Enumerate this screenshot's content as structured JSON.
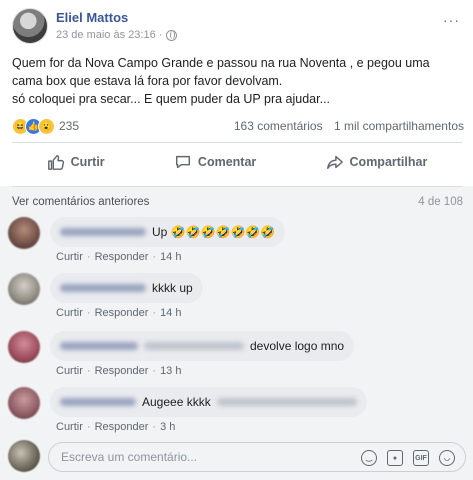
{
  "post": {
    "author": "Eliel Mattos",
    "time": "23 de maio às 23:16 ·",
    "more": "···",
    "text_line1": "Quem for da Nova Campo Grande e passou na rua Noventa , e pegou uma",
    "text_line2": "cama box que estava lá fora por favor devolvam.",
    "text_line3": "só coloquei pra secar... E quem puder da UP pra ajudar...",
    "reaction_count": "235",
    "comments_count": "163 comentários",
    "shares_count": "1 mil compartilhamentos"
  },
  "actions": {
    "like": "Curtir",
    "comment": "Comentar",
    "share": "Compartilhar"
  },
  "comments_section": {
    "previous": "Ver comentários anteriores",
    "count": "4 de 108"
  },
  "comments": [
    {
      "text": "Up 🤣🤣🤣🤣🤣🤣🤣",
      "like": "Curtir",
      "reply": "Responder",
      "time": "14 h"
    },
    {
      "text": "kkkk up",
      "like": "Curtir",
      "reply": "Responder",
      "time": "14 h"
    },
    {
      "text": "devolve logo mno",
      "like": "Curtir",
      "reply": "Responder",
      "time": "13 h"
    },
    {
      "text": "Augeee kkkk",
      "like": "Curtir",
      "reply": "Responder",
      "time": "3 h"
    }
  ],
  "write": {
    "placeholder": "Escreva um comentário...",
    "gif_label": "GIF"
  },
  "icons": {
    "like": "thumbs-up-icon",
    "comment": "speech-bubble-icon",
    "share": "share-arrow-icon",
    "emoji": "smiley-icon",
    "camera": "camera-icon",
    "gif": "gif-icon",
    "sticker": "sticker-icon"
  },
  "colors": {
    "author": "#385898",
    "like_reaction": "#3578e5",
    "bubble": "#e9ebee"
  }
}
